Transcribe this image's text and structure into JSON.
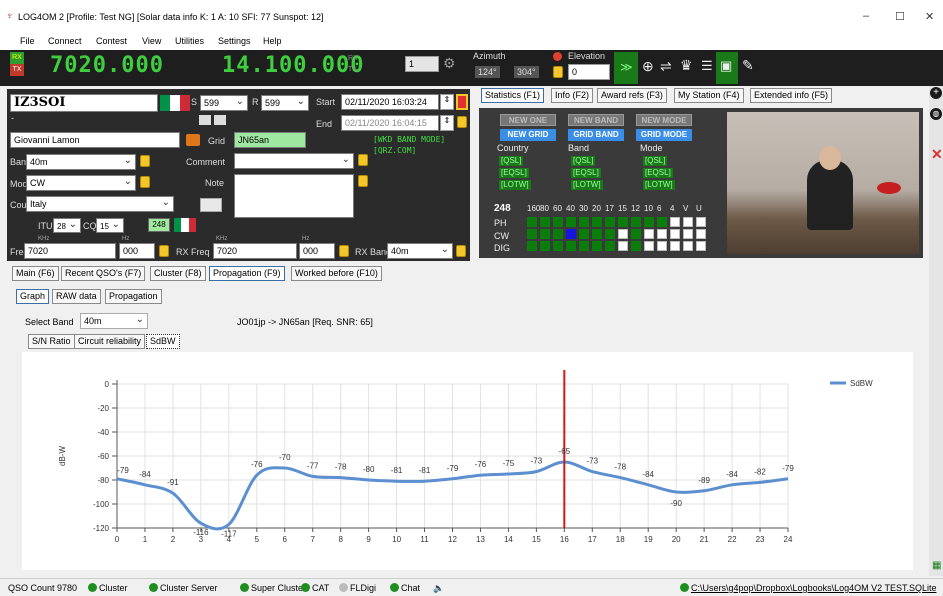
{
  "window": {
    "title": "LOG4OM 2 [Profile: Test NG] [Solar data info K: 1 A: 10 SFI: 77 Sunspot: 12]",
    "minimize": "–",
    "maximize": "☐",
    "close": "✕"
  },
  "menu": [
    "File",
    "Connect",
    "Contest",
    "View",
    "Utilities",
    "Settings",
    "Help"
  ],
  "radio": {
    "rx": "RX",
    "tx": "TX",
    "freq_ghost": "8.020.000",
    "freq": "7020.000",
    "freq2_ghost": "8.14.100.000",
    "freq2": "14.100.000",
    "rx_small": "RX",
    "tx_small": "TX",
    "spin": "1"
  },
  "rotator": {
    "azimuth_label": "Azimuth",
    "az1": "124°",
    "az2": "304°",
    "elevation_label": "Elevation",
    "elevation": "0"
  },
  "qso": {
    "callsign": "IZ3SOI",
    "rst_s_label": "S",
    "rst_s": "599",
    "rst_r_label": "R",
    "rst_r": "599",
    "start_label": "Start",
    "start": "02/11/2020 16:03:24",
    "end_label": "End",
    "end": "02/11/2020 16:04:15",
    "dash": "-",
    "name": "Giovanni Lamon",
    "grid_label": "Grid",
    "grid": "JN65an",
    "wkd": "[WKD BAND MODE]",
    "qrz": "[QRZ.COM]",
    "band_label": "Band",
    "band": "40m",
    "comment_label": "Comment",
    "comment": "",
    "mode_label": "Mode",
    "mode": "CW",
    "note_label": "Note",
    "country_label": "Country",
    "country": "Italy",
    "itu_label": "ITU",
    "itu": "28",
    "cq_label": "CQ",
    "cq": "15",
    "dxcc": "248",
    "khz1": "KHz",
    "freq_label": "Freq",
    "freq": "7020",
    "hz1": "Hz",
    "freq_hz": "000",
    "khz2": "KHz",
    "rxfreq_label": "RX Freq",
    "rxfreq": "7020",
    "hz2": "Hz",
    "rxfreq_hz": "000",
    "rxband_label": "RX Band",
    "rxband": "40m"
  },
  "top_tabs": [
    "Statistics (F1)",
    "Info (F2)",
    "Award refs (F3)",
    "My Station (F4)",
    "Extended info (F5)"
  ],
  "stats": {
    "headers": [
      "NEW ONE",
      "NEW BAND",
      "NEW MODE"
    ],
    "grid_headers": [
      "NEW GRID",
      "GRID BAND",
      "GRID MODE"
    ],
    "col_labels": [
      "Country",
      "Band",
      "Mode"
    ],
    "confirm": [
      "[QSL]",
      "[EQSL]",
      "[LOTW]"
    ],
    "dxcc": "248",
    "bands": [
      "160",
      "80",
      "60",
      "40",
      "30",
      "20",
      "17",
      "15",
      "12",
      "10",
      "6",
      "4",
      "V",
      "U"
    ],
    "rows": [
      "PH",
      "CW",
      "DIG"
    ]
  },
  "bottom_tabs": [
    "Main (F6)",
    "Recent QSO's (F7)",
    "Cluster (F8)",
    "Propagation (F9)",
    "Worked before (F10)"
  ],
  "sub_tabs": [
    "Graph",
    "RAW data",
    "Propagation"
  ],
  "select_band_label": "Select Band",
  "select_band": "40m",
  "path_info": "JO01jp -> JN65an [Req. SNR: 65]",
  "graph_buttons": [
    "S/N Ratio",
    "Circuit reliability",
    "SdBW"
  ],
  "chart_data": {
    "type": "line",
    "title": "",
    "xlabel": "",
    "ylabel": "dB-W",
    "xlim": [
      0,
      24
    ],
    "ylim": [
      -120,
      0
    ],
    "x_ticks": [
      0,
      1,
      2,
      3,
      4,
      5,
      6,
      7,
      8,
      9,
      10,
      11,
      12,
      13,
      14,
      15,
      16,
      17,
      18,
      19,
      20,
      21,
      22,
      23,
      24
    ],
    "y_ticks": [
      0,
      -20,
      -40,
      -60,
      -80,
      -100,
      -120
    ],
    "series": [
      {
        "name": "SdBW",
        "color": "#5b8fd0",
        "x": [
          0,
          1,
          2,
          3,
          4,
          5,
          6,
          7,
          8,
          9,
          10,
          11,
          12,
          13,
          14,
          15,
          16,
          17,
          18,
          19,
          20,
          21,
          22,
          23,
          24
        ],
        "values": [
          -79,
          -84,
          -91,
          -116,
          -117,
          -76,
          -70,
          -77,
          -78,
          -80,
          -81,
          -81,
          -79,
          -76,
          -75,
          -73,
          -65,
          -73,
          -78,
          -84,
          -90,
          -89,
          -84,
          -82,
          -79
        ]
      }
    ],
    "marker_x": 16,
    "marker_color": "#d01818",
    "legend": "top-right",
    "grid": true
  },
  "status": {
    "qso_count": "QSO Count  9780",
    "items": [
      "Cluster",
      "Cluster Server",
      "Super Cluster",
      "CAT",
      "FLDigi",
      "Chat"
    ],
    "path": "C:\\Users\\g4pop\\Dropbox\\Logbooks\\Log4OM V2 TEST.SQLite"
  }
}
